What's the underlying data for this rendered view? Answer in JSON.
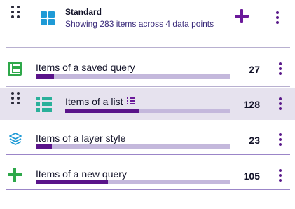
{
  "header": {
    "title": "Standard",
    "subtitle": "Showing 283 items across 4 data points",
    "icon": "grid-icon",
    "add_icon": "plus-icon",
    "menu_icon": "kebab-menu-icon"
  },
  "colors": {
    "accent": "#6b1a9a",
    "bar_fill": "#5a148a",
    "bar_track": "#c4b8dc",
    "selected_row": "#e6e2ee",
    "green": "#2ea84a",
    "teal": "#2ab09a",
    "blue": "#1e9ad6"
  },
  "rows": [
    {
      "label": "Items of a saved query",
      "count": "27",
      "fraction": 0.0954,
      "icon": "save-icon",
      "selected": false
    },
    {
      "label": "Items of a list",
      "count": "128",
      "fraction": 0.4523,
      "icon": "list-icon",
      "label_icon": "list-glyph-icon",
      "selected": true
    },
    {
      "label": "Items of a layer style",
      "count": "23",
      "fraction": 0.0813,
      "icon": "layers-icon",
      "selected": false
    },
    {
      "label": "Items of a new query",
      "count": "105",
      "fraction": 0.371,
      "icon": "plus-icon",
      "selected": false
    }
  ]
}
